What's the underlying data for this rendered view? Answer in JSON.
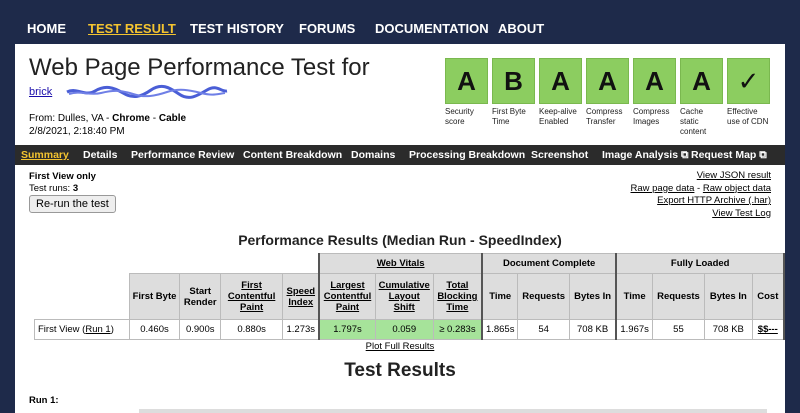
{
  "top_nav": {
    "items": [
      "HOME",
      "TEST RESULT",
      "TEST HISTORY",
      "FORUMS",
      "DOCUMENTATION",
      "ABOUT"
    ],
    "active": "TEST RESULT"
  },
  "header": {
    "title": "Web Page Performance Test for",
    "url_text": "brick",
    "from_prefix": "From: Dulles, VA - ",
    "from_browser": "Chrome",
    "from_sep": " - ",
    "from_connection": "Cable",
    "date": "2/8/2021, 2:18:40 PM"
  },
  "grades": [
    {
      "grade": "A",
      "label": "Security score"
    },
    {
      "grade": "B",
      "label": "First Byte Time"
    },
    {
      "grade": "A",
      "label": "Keep-alive Enabled"
    },
    {
      "grade": "A",
      "label": "Compress Transfer"
    },
    {
      "grade": "A",
      "label": "Compress Images"
    },
    {
      "grade": "A",
      "label": "Cache static content"
    },
    {
      "grade": "✓",
      "label": "Effective use of CDN"
    }
  ],
  "sub_nav": {
    "items": [
      "Summary",
      "Details",
      "Performance Review",
      "Content Breakdown",
      "Domains",
      "Processing Breakdown",
      "Screenshot",
      "Image Analysis ⧉",
      "Request Map ⧉"
    ],
    "active": "Summary"
  },
  "summary": {
    "first_view_only": "First View only",
    "test_runs_label": "Test runs: ",
    "test_runs_value": "3",
    "rerun_button": "Re-run the test"
  },
  "result_links": {
    "view_json": "View JSON result",
    "raw_page": "Raw page data",
    "dash": " - ",
    "raw_object": "Raw object data",
    "export_har": "Export HTTP Archive (.har)",
    "view_log": "View Test Log"
  },
  "performance": {
    "heading": "Performance Results (Median Run - SpeedIndex)",
    "groups": {
      "web_vitals": "Web Vitals",
      "document_complete": "Document Complete",
      "fully_loaded": "Fully Loaded"
    },
    "columns": {
      "first_byte": "First Byte",
      "start_render": "Start Render",
      "fcp": "First Contentful Paint",
      "speed_index": "Speed Index",
      "lcp": "Largest Contentful Paint",
      "cls": "Cumulative Layout Shift",
      "tbt": "Total Blocking Time",
      "dc_time": "Time",
      "dc_requests": "Requests",
      "dc_bytes": "Bytes In",
      "fl_time": "Time",
      "fl_requests": "Requests",
      "fl_bytes": "Bytes In",
      "cost": "Cost"
    },
    "row": {
      "label": "First View (",
      "run_link": "Run 1",
      "label_end": ")",
      "first_byte": "0.460s",
      "start_render": "0.900s",
      "fcp": "0.880s",
      "speed_index": "1.273s",
      "lcp": "1.797s",
      "cls": "0.059",
      "tbt": "≥ 0.283s",
      "dc_time": "1.865s",
      "dc_requests": "54",
      "dc_bytes": "708 KB",
      "fl_time": "1.967s",
      "fl_requests": "55",
      "fl_bytes": "708 KB",
      "cost": "$$---"
    },
    "plot_link": "Plot Full Results"
  },
  "test_results": {
    "heading": "Test Results",
    "run_label": "Run 1:"
  }
}
